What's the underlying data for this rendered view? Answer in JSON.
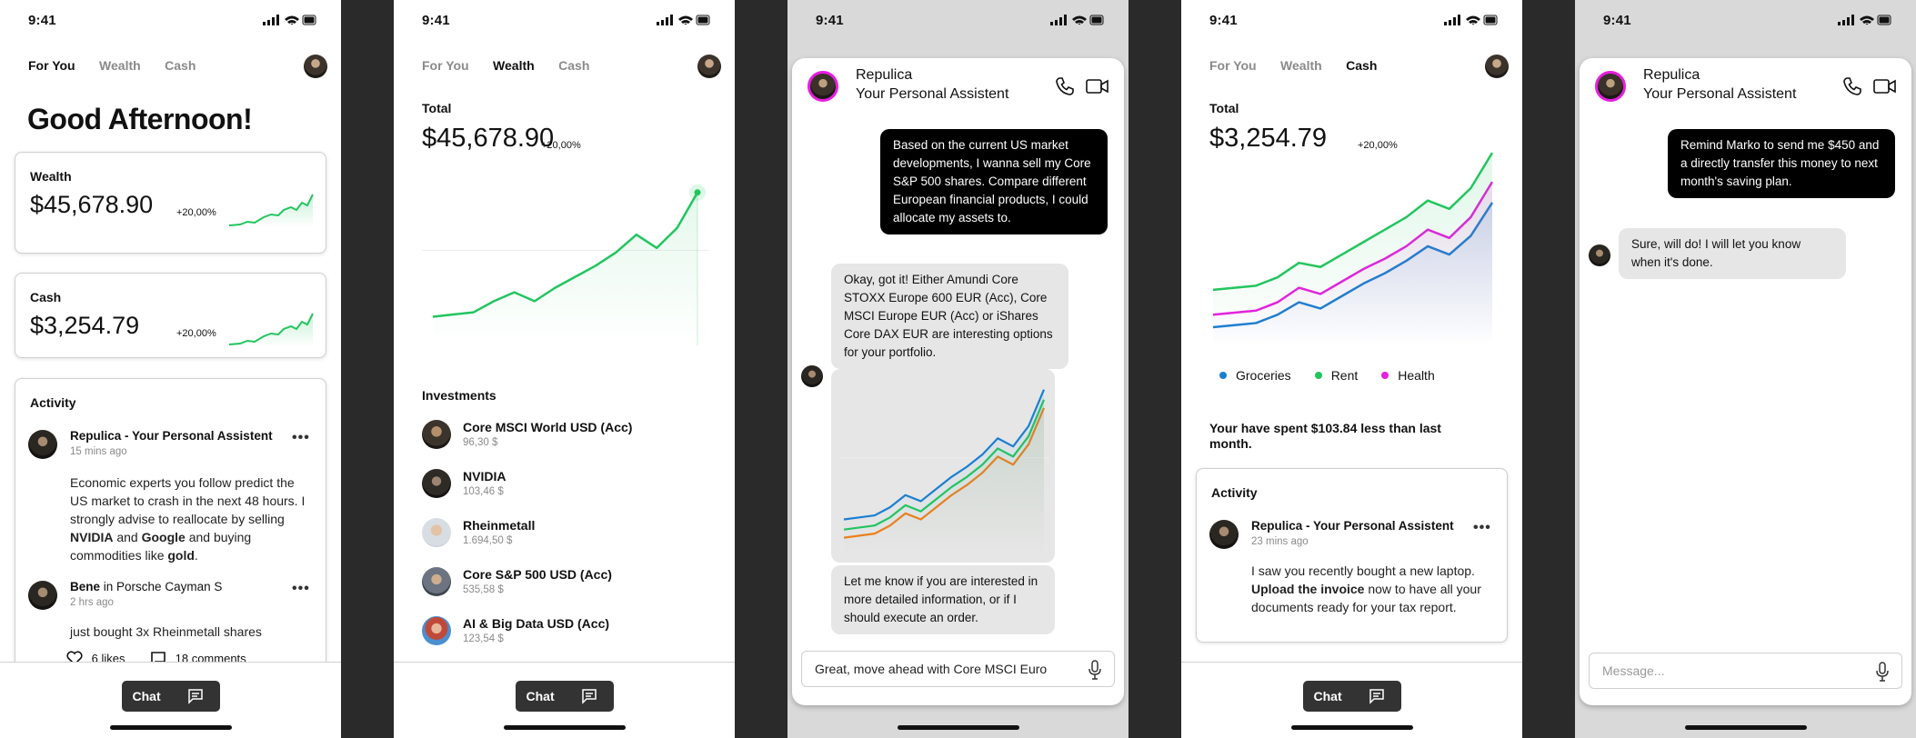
{
  "status": {
    "time": "9:41"
  },
  "nav": {
    "tabs": [
      "For You",
      "Wealth",
      "Cash"
    ]
  },
  "screen1": {
    "greeting": "Good Afternoon!",
    "wealth": {
      "label": "Wealth",
      "amount": "$45,678.90",
      "change": "+20,00%"
    },
    "cash": {
      "label": "Cash",
      "amount": "$3,254.79",
      "change": "+20,00%"
    },
    "activity": {
      "title": "Activity",
      "post1": {
        "author": "Repulica - Your Personal Assistent",
        "time": "15 mins ago",
        "body_html": "Economic experts you follow predict the US market to crash in the next 48 hours. I strongly advise to reallocate by selling <b>NVIDIA</b> and <b>Google</b> and buying commodities like <b>gold</b>."
      },
      "post2": {
        "author": "Bene",
        "in": "in Porsche Cayman S",
        "time": "2 hrs ago",
        "body": "just bought 3x Rheinmetall shares",
        "likes": "6 likes",
        "comments": "18 comments"
      },
      "more": "•••"
    }
  },
  "screen2": {
    "total_label": "Total",
    "total": "$45,678.90",
    "change": "+20,00%",
    "chart_data": {
      "type": "line",
      "series": [
        {
          "values": [
            20,
            21,
            22,
            27,
            31,
            27,
            33,
            38,
            43,
            49,
            57,
            51,
            60,
            76
          ]
        }
      ]
    },
    "investments_title": "Investments",
    "investments": [
      {
        "name": "Core MSCI World USD (Acc)",
        "price": "96,30 $"
      },
      {
        "name": "NVIDIA",
        "price": "103,46 $"
      },
      {
        "name": "Rheinmetall",
        "price": "1.694,50 $"
      },
      {
        "name": "Core S&P 500 USD (Acc)",
        "price": "535,58 $"
      },
      {
        "name": "AI & Big Data USD (Acc)",
        "price": "123,54 $"
      }
    ]
  },
  "chat": {
    "name": "Repulica",
    "subtitle": "Your Personal Assistent",
    "screen3": {
      "out1": "Based on the current US market developments, I wanna sell my Core S&P 500 shares. Compare different European financial products, I could allocate my assets to.",
      "in1": "Okay, got it! Either Amundi Core STOXX Europe 600 EUR (Acc), Core MSCI Europe EUR (Acc) or iShares Core DAX EUR are interesting options for your portfolio.",
      "in2": "Let me know if you are interested in more detailed information, or if I should execute an order.",
      "input": "Great, move ahead with Core MSCI Euro"
    },
    "screen5": {
      "out1": "Remind Marko to send me $450 and a directly transfer this money to next month's saving plan.",
      "in1": "Sure, will do! I will let you know when it's done.",
      "placeholder": "Message..."
    }
  },
  "screen4": {
    "total_label": "Total",
    "total": "$3,254.79",
    "change": "+20,00%",
    "chart_data": {
      "type": "area",
      "series": [
        {
          "name": "Groceries",
          "color": "#1a7fd1",
          "values": [
            12,
            13,
            14,
            18,
            24,
            21,
            27,
            33,
            38,
            44,
            51,
            47,
            56,
            72
          ]
        },
        {
          "name": "Rent",
          "color": "#22c55e",
          "values": [
            30,
            31,
            32,
            36,
            43,
            41,
            47,
            53,
            59,
            65,
            73,
            69,
            79,
            96
          ]
        },
        {
          "name": "Health",
          "color": "#e81ee0",
          "values": [
            18,
            19,
            20,
            24,
            31,
            28,
            34,
            40,
            45,
            51,
            59,
            55,
            65,
            82
          ]
        }
      ]
    },
    "spent_note": "Your have spent $103.84 less than last month.",
    "activity_title": "Activity",
    "post": {
      "author": "Repulica - Your Personal Assistent",
      "time": "23 mins ago",
      "body_html": "I saw you recently bought a new laptop. <b>Upload the invoice</b> now to have all your documents ready for your tax report."
    }
  },
  "bottom": {
    "chat_label": "Chat"
  },
  "colors": {
    "green": "#22c55e",
    "blue": "#1a7fd1",
    "magenta": "#e81ee0",
    "orange": "#f07f1a",
    "dark": "#333333"
  }
}
